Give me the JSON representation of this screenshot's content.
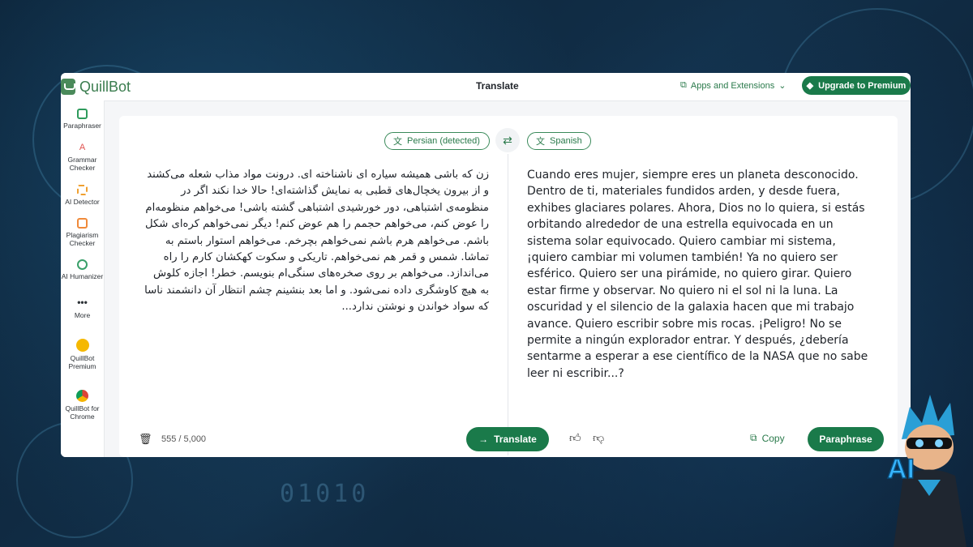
{
  "app": {
    "logo": "QuillBot",
    "title": "Translate",
    "apps_label": "Apps and Extensions",
    "upgrade_label": "Upgrade to Premium"
  },
  "sidebar": {
    "items": [
      {
        "label": "Paraphraser",
        "icon": "paraphraser-icon",
        "color": "#2e9b5c"
      },
      {
        "label": "Grammar Checker",
        "icon": "grammar-icon",
        "color": "#e0524f"
      },
      {
        "label": "AI Detector",
        "icon": "ai-detector-icon",
        "color": "#f0a030"
      },
      {
        "label": "Plagiarism Checker",
        "icon": "plagiarism-icon",
        "color": "#f08a3a"
      },
      {
        "label": "AI Humanizer",
        "icon": "humanizer-icon",
        "color": "#3aa06a"
      },
      {
        "label": "More",
        "icon": "more-icon",
        "color": "#333333"
      },
      {
        "label": "QuillBot Premium",
        "icon": "premium-icon",
        "color": "#f5b800"
      },
      {
        "label": "QuillBot for Chrome",
        "icon": "chrome-icon",
        "color": "#4285f4"
      }
    ]
  },
  "translator": {
    "source_lang": "Persian (detected)",
    "target_lang": "Spanish",
    "source_text": "زن که باشی همیشه سیاره ای ناشناخته ای. درونت مواد مذاب شعله می‌کشند و از بیرون یخچال‌های قطبی به نمایش گذاشته‌ای! حالا خدا نکند اگر در منظومه‌ی اشتباهی، دور خورشیدی اشتباهی گشته باشی! می‌خواهم منظومه‌ام را عوض کنم، می‌خواهم حجمم را هم عوض کنم! دیگر نمی‌خواهم کره‌ای شکل باشم. می‌خواهم هرم باشم نمی‌خواهم بچرخم. می‌خواهم استوار باستم به تماشا. شمس و قمر هم نمی‌خواهم. تاریکی و سکوت کهکشان کارم را راه می‌اندازد. می‌خواهم بر روی صخره‌های سنگی‌ام بنویسم. خطر! اجازه کلوش به هیچ کاوشگری داده نمی‌شود. و اما بعد بنشینم چشم انتظار آن دانشمند ناسا که سواد خواندن و نوشتن ندارد...",
    "target_text": "Cuando eres mujer, siempre eres un planeta desconocido. Dentro de ti, materiales fundidos arden, y desde fuera, exhibes glaciares polares. Ahora, Dios no lo quiera, si estás orbitando alrededor de una estrella equivocada en un sistema solar equivocado. Quiero cambiar mi sistema, ¡quiero cambiar mi volumen también! Ya no quiero ser esférico. Quiero ser una pirámide, no quiero girar. Quiero estar firme y observar. No quiero ni el sol ni la luna. La oscuridad y el silencio de la galaxia hacen que mi trabajo avance. Quiero escribir sobre mis rocas. ¡Peligro! No se permite a ningún explorador entrar. Y después, ¿debería sentarme a esperar a ese científico de la NASA que no sabe leer ni escribir...?",
    "char_count": "555 / 5,000",
    "translate_label": "Translate",
    "copy_label": "Copy",
    "paraphrase_label": "Paraphrase"
  },
  "background": {
    "binary_text": "01010"
  }
}
